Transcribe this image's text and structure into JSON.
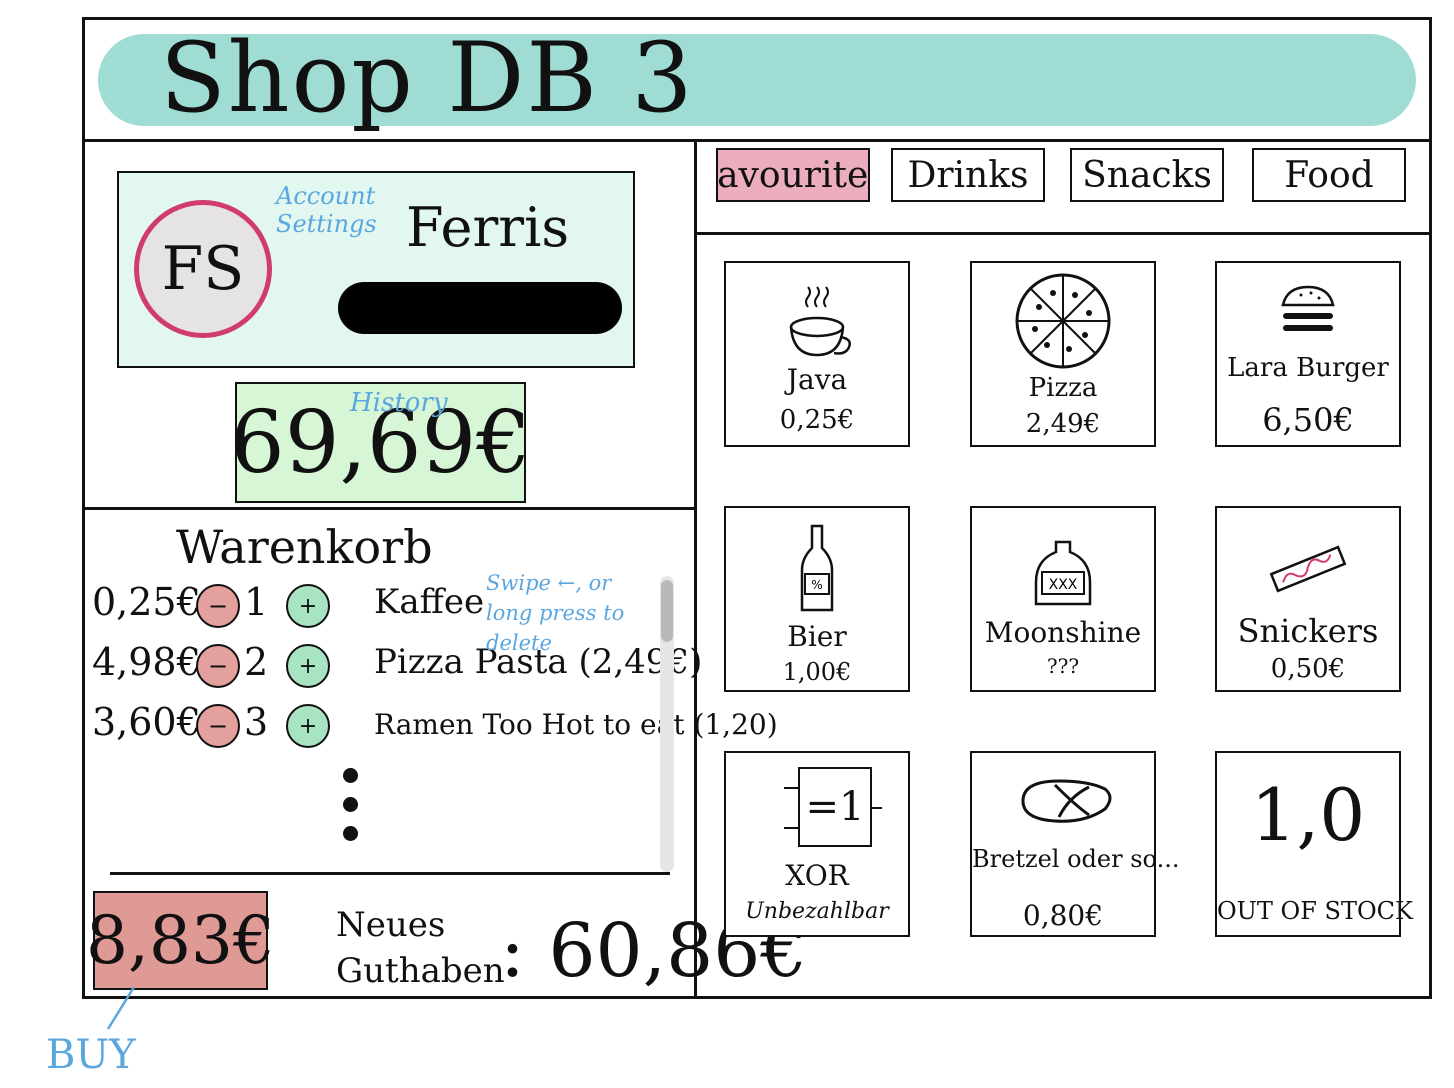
{
  "app": {
    "title": "Shop DB 3"
  },
  "account": {
    "initials": "FS",
    "settings_link": "Account Settings",
    "first_name": "Ferris",
    "balance": "69,69€",
    "history_link": "History"
  },
  "cart": {
    "title": "Warenkorb",
    "hint": "Swipe ←, or long press to delete",
    "minus_symbol": "−",
    "plus_symbol": "+",
    "items": [
      {
        "total": "0,25€",
        "quantity": "1",
        "name": "Kaffee"
      },
      {
        "total": "4,98€",
        "quantity": "2",
        "name": "Pizza Pasta (2,49€)"
      },
      {
        "total": "3,60€",
        "quantity": "3",
        "name": "Ramen Too Hot to eat (1,20)"
      }
    ]
  },
  "checkout": {
    "total": "8,83€",
    "buy_label": "BUY",
    "new_balance_label_line1": "Neues",
    "new_balance_label_line2": "Guthaben",
    "new_balance_value": ": 60,86€"
  },
  "tabs": [
    {
      "label": "Favouriten",
      "active": true
    },
    {
      "label": "Drinks"
    },
    {
      "label": "Snacks"
    },
    {
      "label": "Food"
    }
  ],
  "products": [
    {
      "name": "Java",
      "price": "0,25€",
      "icon": "coffee-cup-icon"
    },
    {
      "name": "Pizza",
      "price": "2,49€",
      "icon": "pizza-icon"
    },
    {
      "name": "Lara Burger",
      "price": "6,50€",
      "icon": "burger-icon"
    },
    {
      "name": "Bier",
      "price": "1,00€",
      "icon": "beer-bottle-icon"
    },
    {
      "name": "Moonshine",
      "price": "???",
      "icon": "moonshine-jug-icon"
    },
    {
      "name": "Snickers",
      "price": "0,50€",
      "icon": "snickers-bar-icon"
    },
    {
      "name": "XOR",
      "note": "Unbezahlbar",
      "icon": "xor-gate-icon",
      "icon_text": "=1"
    },
    {
      "name": "Bretzel oder so...",
      "price": "0,80€",
      "icon": "pretzel-icon"
    },
    {
      "name": "OUT OF STOCK",
      "icon_text": "1,0",
      "icon": "grade-text"
    }
  ],
  "colors": {
    "header": "#9fddd4",
    "account_bg": "#e3f7f1",
    "avatar_ring": "#d03c6c",
    "balance_bg": "#d7f6d6",
    "buy_bg": "#df9a96",
    "minus_bg": "#e3a09c",
    "plus_bg": "#a9e4c2",
    "active_tab": "#ecaebe",
    "hint_text": "#5aa6df"
  }
}
